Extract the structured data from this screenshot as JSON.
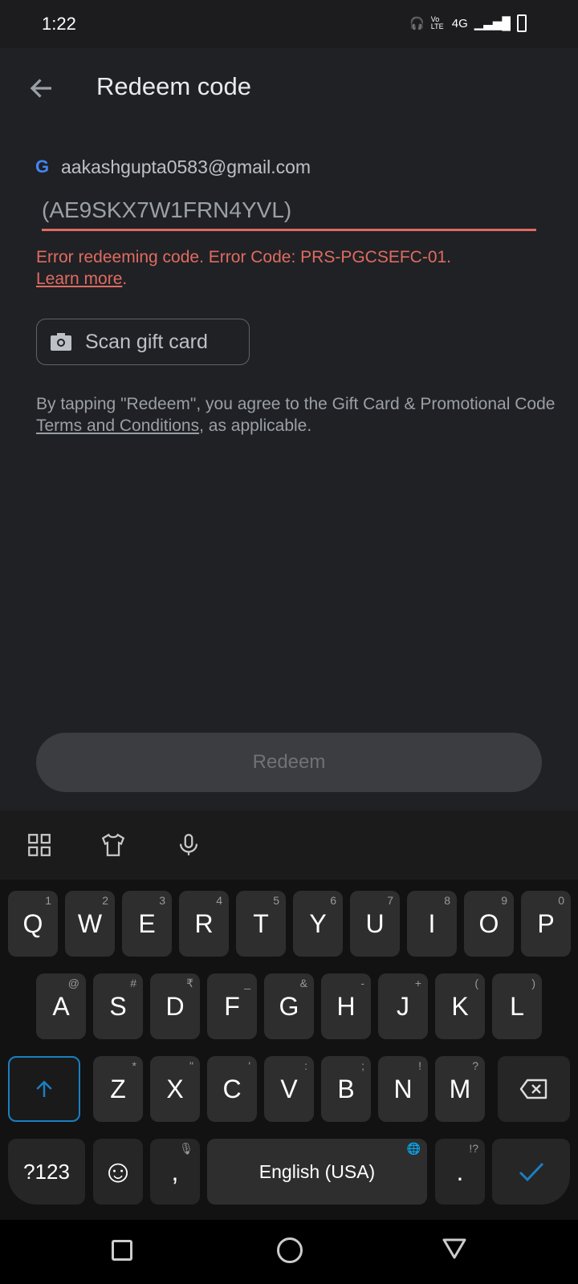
{
  "status_bar": {
    "time": "1:22",
    "icons": [
      "headphones-icon",
      "volte-icon",
      "4g-icon",
      "signal-icon",
      "battery-icon"
    ],
    "network": "4G",
    "volte": "Vo LTE"
  },
  "header": {
    "title": "Redeem code",
    "back_icon": "arrow-left-icon"
  },
  "account": {
    "email": "aakashgupta0583@gmail.com",
    "icon": "google-g-icon"
  },
  "code_input": {
    "value": "(AE9SKX7W1FRN4YVL)"
  },
  "error": {
    "message": "Error redeeming code. Error Code: PRS-PGCSEFC-01.",
    "link": "Learn more",
    "suffix": ".",
    "color": "#e06b62"
  },
  "scan_button": {
    "label": "Scan gift card",
    "icon": "camera-icon"
  },
  "terms": {
    "prefix": "By tapping \"Redeem\", you agree to the Gift Card & Promotional Code ",
    "link": "Terms and Conditions",
    "suffix": ", as applicable."
  },
  "redeem_button": {
    "label": "Redeem",
    "enabled": false
  },
  "keyboard": {
    "toolbar": [
      "apps-grid-icon",
      "theme-shirt-icon",
      "microphone-icon"
    ],
    "row1": [
      [
        "Q",
        "1"
      ],
      [
        "W",
        "2"
      ],
      [
        "E",
        "3"
      ],
      [
        "R",
        "4"
      ],
      [
        "T",
        "5"
      ],
      [
        "Y",
        "6"
      ],
      [
        "U",
        "7"
      ],
      [
        "I",
        "8"
      ],
      [
        "O",
        "9"
      ],
      [
        "P",
        "0"
      ]
    ],
    "row2": [
      [
        "A",
        "@"
      ],
      [
        "S",
        "#"
      ],
      [
        "D",
        "₹"
      ],
      [
        "F",
        "_"
      ],
      [
        "G",
        "&"
      ],
      [
        "H",
        "-"
      ],
      [
        "J",
        "+"
      ],
      [
        "K",
        "("
      ],
      [
        "L",
        ")"
      ]
    ],
    "row3": [
      [
        "Z",
        "*"
      ],
      [
        "X",
        "\""
      ],
      [
        "C",
        "'"
      ],
      [
        "V",
        ":"
      ],
      [
        "B",
        ";"
      ],
      [
        "N",
        "!"
      ],
      [
        "M",
        "?"
      ]
    ],
    "symbols_key": "?123",
    "comma": ",",
    "space": "English (USA)",
    "period": ".",
    "period_hint": "!?"
  },
  "nav_bar": [
    "recents-square-icon",
    "home-circle-icon",
    "back-triangle-icon"
  ]
}
